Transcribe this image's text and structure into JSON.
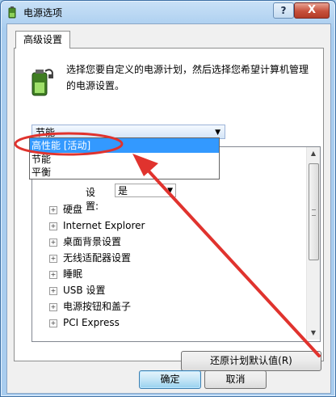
{
  "window": {
    "title": "电源选项",
    "help_label": "?",
    "close_label": "X"
  },
  "tab": {
    "label": "高级设置"
  },
  "description": "选择您要自定义的电源计划，然后选择您希望计算机管理的电源设置。",
  "plan_combo": {
    "selected": "节能"
  },
  "dropdown": {
    "options": [
      "高性能 [活动]",
      "节能",
      "平衡"
    ],
    "highlighted_index": 0
  },
  "setting": {
    "label": "设置:",
    "value": "是"
  },
  "tree": {
    "items": [
      "硬盘",
      "Internet Explorer",
      "桌面背景设置",
      "无线适配器设置",
      "睡眠",
      "USB 设置",
      "电源按钮和盖子",
      "PCI Express"
    ]
  },
  "buttons": {
    "reset": "还原计划默认值(R)",
    "ok": "确定",
    "cancel": "取消"
  },
  "colors": {
    "annotation": "#e0332e",
    "selection": "#3399ff"
  }
}
